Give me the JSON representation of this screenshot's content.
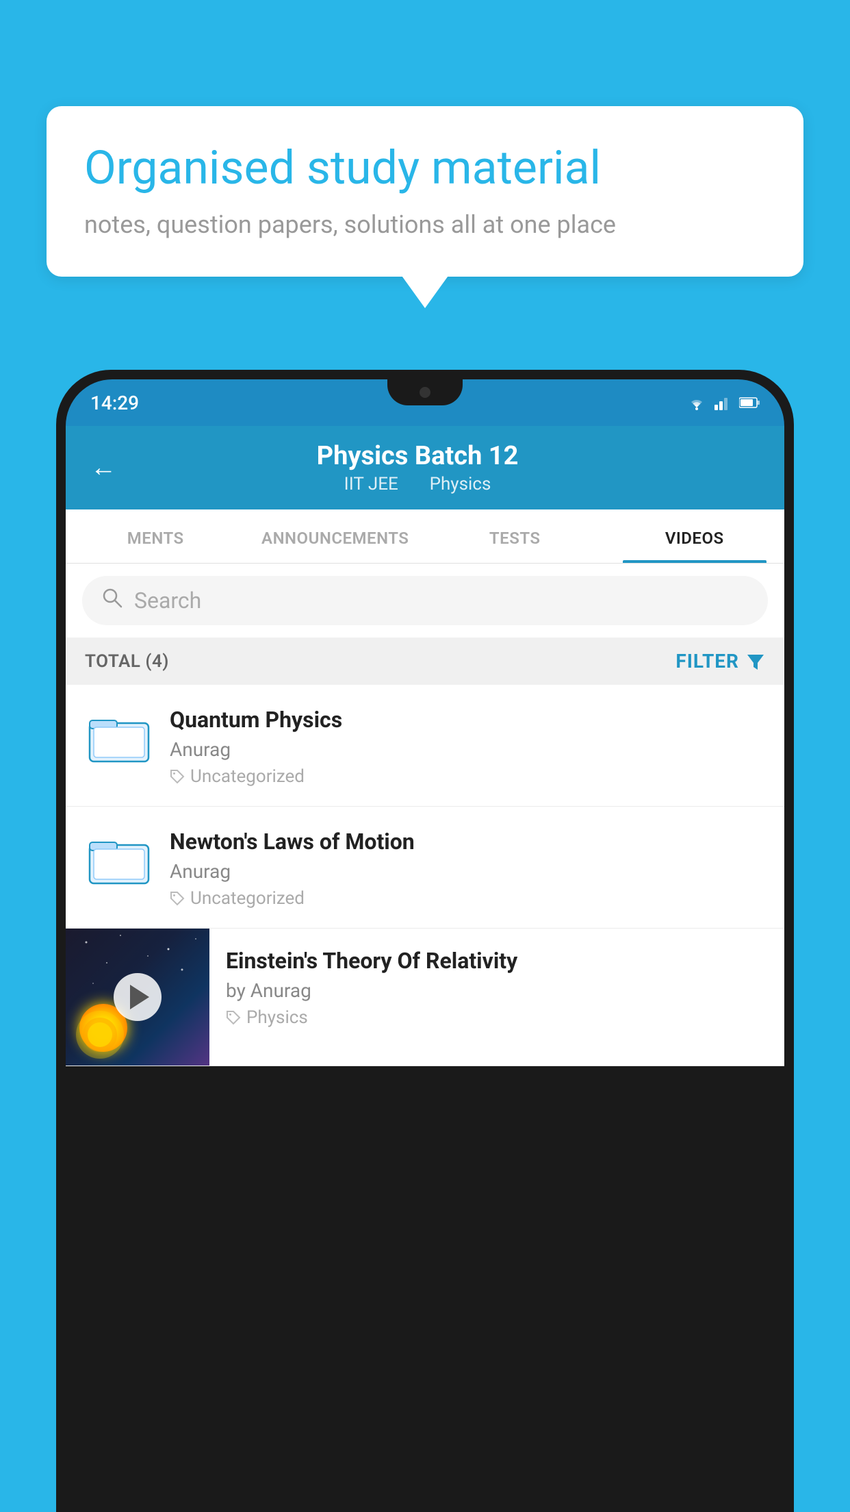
{
  "background_color": "#29b6e8",
  "bubble": {
    "title": "Organised study material",
    "subtitle": "notes, question papers, solutions all at one place"
  },
  "status_bar": {
    "time": "14:29",
    "icons": [
      "wifi",
      "signal",
      "battery"
    ]
  },
  "header": {
    "title": "Physics Batch 12",
    "subtitle_part1": "IIT JEE",
    "subtitle_part2": "Physics",
    "back_label": "←"
  },
  "tabs": [
    {
      "label": "MENTS",
      "active": false
    },
    {
      "label": "ANNOUNCEMENTS",
      "active": false
    },
    {
      "label": "TESTS",
      "active": false
    },
    {
      "label": "VIDEOS",
      "active": true
    }
  ],
  "search": {
    "placeholder": "Search"
  },
  "filter": {
    "total_label": "TOTAL (4)",
    "filter_label": "FILTER"
  },
  "videos": [
    {
      "title": "Quantum Physics",
      "author": "Anurag",
      "tag": "Uncategorized",
      "type": "folder",
      "thumbnail": null
    },
    {
      "title": "Newton's Laws of Motion",
      "author": "Anurag",
      "tag": "Uncategorized",
      "type": "folder",
      "thumbnail": null
    },
    {
      "title": "Einstein's Theory Of Relativity",
      "author": "by Anurag",
      "tag": "Physics",
      "type": "video",
      "thumbnail": "space"
    }
  ]
}
